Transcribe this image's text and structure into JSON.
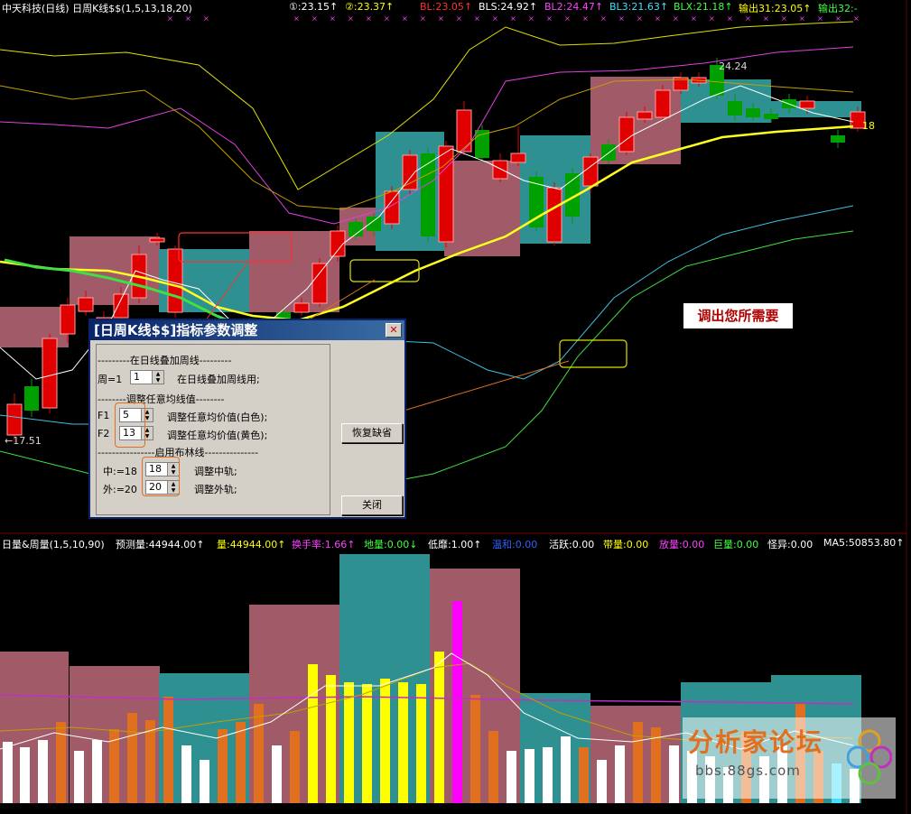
{
  "header": {
    "title": "中天科技(日线) 日周K线$$(1,5,13,18,20)",
    "items": [
      {
        "text": "①:23.15↑",
        "color": "#ffffff"
      },
      {
        "text": "②:23.37↑",
        "color": "#ffff00"
      },
      {
        "text": "BL:23.05↑",
        "color": "#ff3030"
      },
      {
        "text": "BLS:24.92↑",
        "color": "#ffffff"
      },
      {
        "text": "BL2:24.47↑",
        "color": "#ff40ff"
      },
      {
        "text": "BL3:21.63↑",
        "color": "#40e0ff"
      },
      {
        "text": "BLX:21.18↑",
        "color": "#40ff40"
      },
      {
        "text": "输出31:23.05↑",
        "color": "#ffff00"
      },
      {
        "text": "输出32:-",
        "color": "#40ff40"
      }
    ]
  },
  "price_labels": {
    "high": "24.24",
    "low": "←17.51",
    "right": "18"
  },
  "annotation": "调出您所需要",
  "dialog": {
    "title": "[日周K线$$]指标参数调整",
    "sections": {
      "weekly": "---------在日线叠加周线---------",
      "ma": "--------调整任意均线值--------",
      "boll": "----------------启用布林线---------------"
    },
    "rows": {
      "week_label": "周=1",
      "week_value": "1",
      "week_desc": "在日线叠加周线用;",
      "f1_label": "F1",
      "f1_value": "5",
      "f1_desc": "调整任意均价值(白色);",
      "f2_label": "F2",
      "f2_value": "13",
      "f2_desc": "调整任意均价值(黄色);",
      "mid_label": "中:=18",
      "mid_value": "18",
      "mid_desc": "调整中轨;",
      "out_label": "外:=20",
      "out_value": "20",
      "out_desc": "调整外轨;"
    },
    "buttons": {
      "restore": "恢复缺省",
      "close": "关闭"
    }
  },
  "volume_header": {
    "title": "日量&周量(1,5,10,90)",
    "items": [
      {
        "text": "预测量:44944.00↑",
        "color": "#ffffff"
      },
      {
        "text": "量:44944.00↑",
        "color": "#ffff00"
      },
      {
        "text": "换手率:1.66↑",
        "color": "#ff40ff"
      },
      {
        "text": "地量:0.00↓",
        "color": "#40ff40"
      },
      {
        "text": "低靡:1.00↑",
        "color": "#ffffff"
      },
      {
        "text": "温和:0.00",
        "color": "#3060ff"
      },
      {
        "text": "活跃:0.00",
        "color": "#ffffff"
      },
      {
        "text": "带量:0.00",
        "color": "#ffff00"
      },
      {
        "text": "放量:0.00",
        "color": "#ff40ff"
      },
      {
        "text": "巨量:0.00",
        "color": "#40ff40"
      },
      {
        "text": "怪异:0.00",
        "color": "#ffffff"
      },
      {
        "text": "MA5:50853.80↑",
        "color": "#ffffff"
      }
    ]
  },
  "watermark": {
    "text": "分析家论坛",
    "url": "bbs.88gs.com"
  },
  "colors": {
    "up": "#e00000",
    "down": "#00a000",
    "week_up": "#a05a68",
    "week_down": "#2e9090",
    "orange": "#e07020"
  }
}
